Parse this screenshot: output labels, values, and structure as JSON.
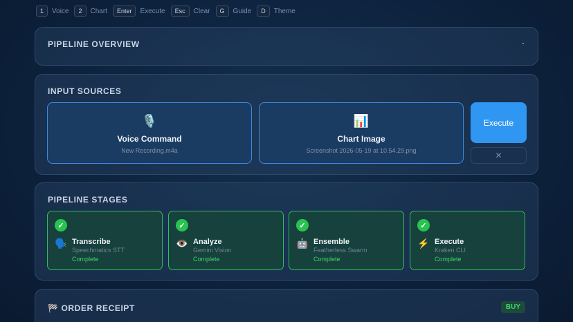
{
  "shortcuts": [
    {
      "key": "1",
      "label": "Voice"
    },
    {
      "key": "2",
      "label": "Chart"
    },
    {
      "key": "Enter",
      "label": "Execute"
    },
    {
      "key": "Esc",
      "label": "Clear"
    },
    {
      "key": "G",
      "label": "Guide"
    },
    {
      "key": "D",
      "label": "Theme"
    }
  ],
  "overview": {
    "title": "PIPELINE OVERVIEW"
  },
  "inputs": {
    "title": "INPUT SOURCES",
    "voice": {
      "icon": "🎙️",
      "label": "Voice Command",
      "file": "New Recording.m4a"
    },
    "chart": {
      "icon": "📊",
      "label": "Chart Image",
      "file": "Screenshot 2026-05-19 at 10.54.29.png"
    },
    "execute_label": "Execute",
    "clear_label": "✕"
  },
  "stages": {
    "title": "PIPELINE STAGES",
    "items": [
      {
        "check": "✓",
        "icon": "🗣️",
        "name": "Transcribe",
        "provider": "Speechmatics STT",
        "status": "Complete"
      },
      {
        "check": "✓",
        "icon": "👁️",
        "name": "Analyze",
        "provider": "Gemini Vision",
        "status": "Complete"
      },
      {
        "check": "✓",
        "icon": "🤖",
        "name": "Ensemble",
        "provider": "Featherless Swarm",
        "status": "Complete"
      },
      {
        "check": "✓",
        "icon": "⚡",
        "name": "Execute",
        "provider": "Kraken CLI",
        "status": "Complete"
      }
    ]
  },
  "receipt": {
    "icon": "🏁",
    "title": "ORDER RECEIPT",
    "badge": "BUY"
  },
  "colors": {
    "accent": "#2f96f2",
    "success": "#28c350",
    "card_border": "#3d8ae0"
  }
}
